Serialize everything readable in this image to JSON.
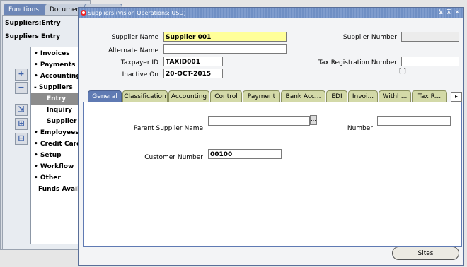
{
  "navigator": {
    "tabs": [
      "Functions",
      "Documents",
      ""
    ],
    "heading": "Suppliers:Entry",
    "subheading": "Suppliers Entry",
    "items": [
      {
        "label": "• Invoices"
      },
      {
        "label": "• Payments"
      },
      {
        "label": "• Accounting"
      },
      {
        "label": "- Suppliers"
      },
      {
        "label": "Entry"
      },
      {
        "label": "Inquiry"
      },
      {
        "label": "Supplier Lists"
      },
      {
        "label": "• Employees"
      },
      {
        "label": "• Credit Cards"
      },
      {
        "label": "• Setup"
      },
      {
        "label": "• Workflow"
      },
      {
        "label": "• Other"
      },
      {
        "label": "Funds Available"
      }
    ],
    "buttons": [
      "+",
      "-",
      "expand-branch",
      "expand-all",
      "collapse-all"
    ]
  },
  "window": {
    "title": "Suppliers (Vision Operations: USD)",
    "controls": "⊻ ⊼ ✕"
  },
  "header": {
    "supplier_name_label": "Supplier Name",
    "supplier_name": "Supplier 001",
    "alternate_name_label": "Alternate Name",
    "alternate_name": "",
    "taxpayer_id_label": "Taxpayer ID",
    "taxpayer_id": "TAXID001",
    "inactive_on_label": "Inactive On",
    "inactive_on": "20-OCT-2015",
    "supplier_number_label": "Supplier Number",
    "supplier_number": "",
    "tax_reg_label": "Tax Registration Number",
    "tax_reg": "",
    "dff_brackets": "[   ]"
  },
  "tabs": [
    "General",
    "Classification",
    "Accounting",
    "Control",
    "Payment",
    "Bank Acc...",
    "EDI",
    "Invoi...",
    "Withh...",
    "Tax R..."
  ],
  "tab_scroll": "▸",
  "general": {
    "parent_supplier_label": "Parent Supplier Name",
    "parent_supplier": "",
    "lov": "...",
    "number_label": "Number",
    "number": "",
    "customer_number_label": "Customer Number",
    "customer_number": "00100"
  },
  "sites_button": "Sites",
  "colors": {
    "active_tab": "#5f7ab3",
    "inactive_tab": "#d3d9a8",
    "required_field": "#ffff99",
    "title_bar": "#6f8fc4"
  }
}
